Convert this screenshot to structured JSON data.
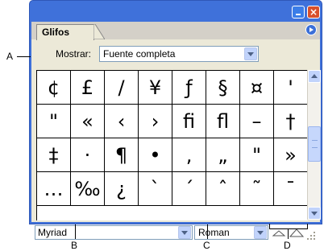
{
  "panel": {
    "tab_title": "Glifos",
    "show_label": "Mostrar:",
    "show_value": "Fuente completa"
  },
  "glyphs": [
    "¢",
    "£",
    "/",
    "¥",
    "ƒ",
    "§",
    "¤",
    "'",
    "\"",
    "«",
    "‹",
    "›",
    "ﬁ",
    "ﬂ",
    "–",
    "†",
    "‡",
    "·",
    "¶",
    "•",
    "‚",
    "„",
    "\"",
    "»",
    "…",
    "‰",
    "¿",
    "`",
    "´",
    "ˆ",
    "˜",
    "¯"
  ],
  "footer": {
    "font_family": "Myriad",
    "font_style": "Roman"
  },
  "callouts": {
    "a": "A",
    "b": "B",
    "c": "C",
    "d": "D"
  },
  "icons": {
    "minimize": "minimize-icon",
    "close": "close-icon",
    "panel_menu": "panel-menu-icon",
    "scroll_up": "scroll-up-icon",
    "scroll_down": "scroll-down-icon",
    "smaller": "small-mountain-icon",
    "larger": "large-mountain-icon"
  },
  "colors": {
    "titlebar": "#3f71da",
    "panel_bg": "#ece9d8",
    "close_button": "#d8502b",
    "dropdown_button": "#c1d3fb"
  }
}
